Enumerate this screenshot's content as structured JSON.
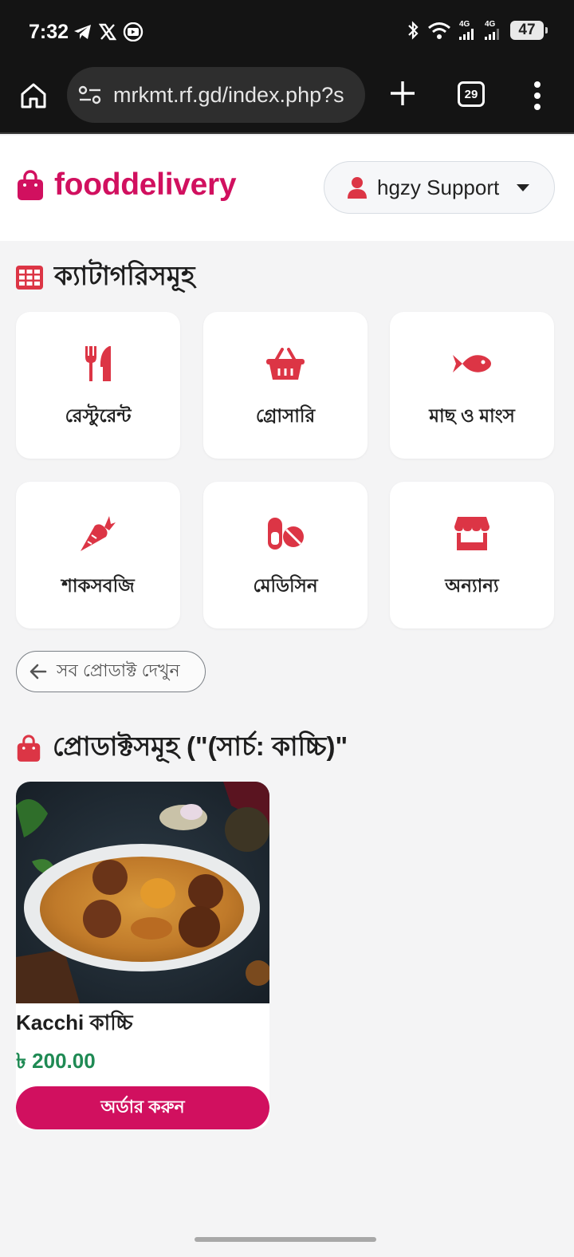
{
  "status_bar": {
    "time": "7:32",
    "left_icons": [
      "telegram-icon",
      "x-icon",
      "youtube-icon"
    ],
    "right_icons": [
      "bluetooth-icon",
      "wifi-icon",
      "signal-4g-icon",
      "signal-4g-icon"
    ],
    "network_1": "4G",
    "network_2": "4G",
    "battery": "47"
  },
  "browser": {
    "url": "mrkmt.rf.gd/index.php?s",
    "tab_count": "29"
  },
  "header": {
    "brand": "fooddelivery",
    "user_button": "hgzy Support"
  },
  "categories": {
    "title": "ক্যাটাগরিসমূহ",
    "items": [
      {
        "label": "রেস্টুরেন্ট",
        "icon": "utensils-icon"
      },
      {
        "label": "গ্রোসারি",
        "icon": "basket-icon"
      },
      {
        "label": "মাছ ও মাংস",
        "icon": "fish-icon"
      },
      {
        "label": "শাকসবজি",
        "icon": "carrot-icon"
      },
      {
        "label": "মেডিসিন",
        "icon": "pills-icon"
      },
      {
        "label": "অন্যান্য",
        "icon": "store-icon"
      }
    ]
  },
  "back_button": "সব প্রোডাক্ট দেখুন",
  "products": {
    "title": "প্রোডাক্টসমূহ (\"(সার্চ: কাচ্চি)\"",
    "items": [
      {
        "name": "Kacchi কাচ্চি",
        "price": "৳ 200.00",
        "order_label": "অর্ডার করুন"
      }
    ]
  },
  "colors": {
    "brand": "#d1105f",
    "icon_red": "#dc3545",
    "price_green": "#1f8a54"
  }
}
